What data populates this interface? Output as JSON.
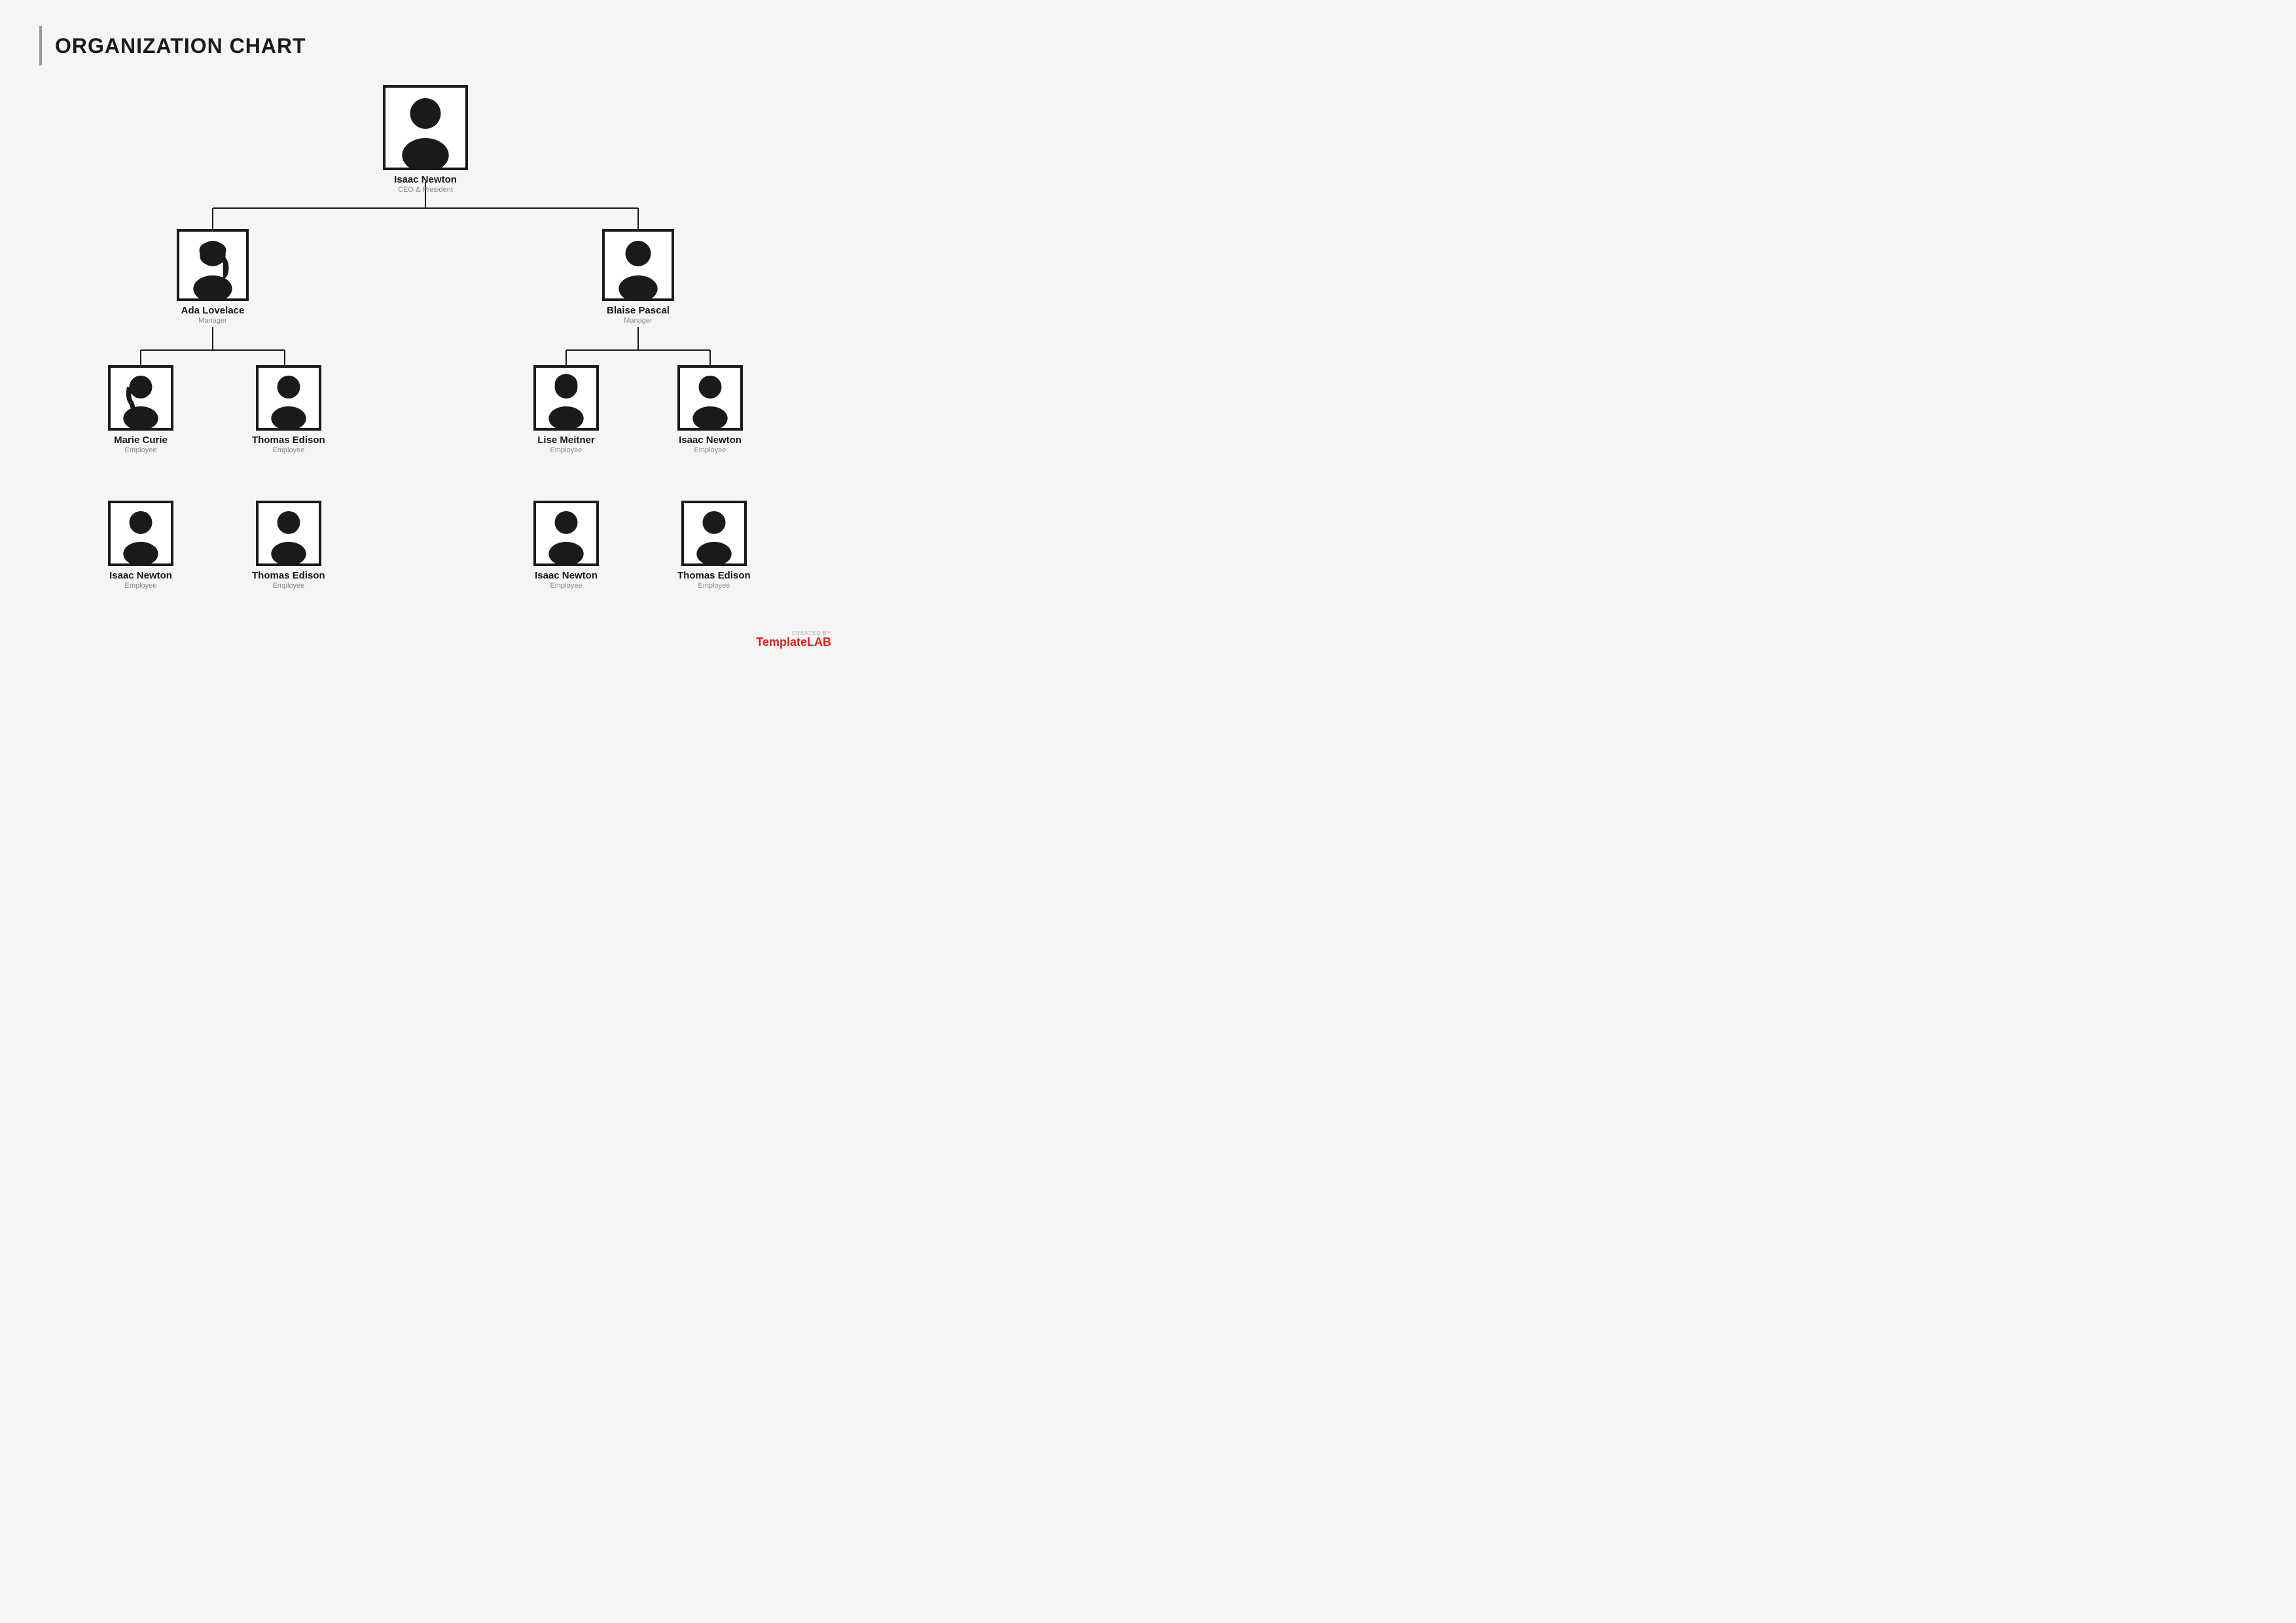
{
  "title": "ORGANIZATION CHART",
  "watermark": {
    "created_by": "CREATED BY",
    "brand_light": "Template",
    "brand_bold": "LAB"
  },
  "nodes": {
    "ceo": {
      "name": "Isaac Newton",
      "role": "CEO & President",
      "size": "large",
      "gender": "male"
    },
    "manager1": {
      "name": "Ada Lovelace",
      "role": "Manager",
      "size": "medium",
      "gender": "female"
    },
    "manager2": {
      "name": "Blaise Pascal",
      "role": "Manager",
      "size": "medium",
      "gender": "male"
    },
    "emp1": {
      "name": "Marie Curie",
      "role": "Employee",
      "size": "small",
      "gender": "female2"
    },
    "emp2": {
      "name": "Thomas Edison",
      "role": "Employee",
      "size": "small",
      "gender": "male2"
    },
    "emp3": {
      "name": "Lise Meitner",
      "role": "Employee",
      "size": "small",
      "gender": "female3"
    },
    "emp4": {
      "name": "Isaac Newton",
      "role": "Employee",
      "size": "small",
      "gender": "male3"
    },
    "emp5": {
      "name": "Isaac Newton",
      "role": "Employee",
      "size": "small",
      "gender": "male4"
    },
    "emp6": {
      "name": "Thomas Edison",
      "role": "Employee",
      "size": "small",
      "gender": "male5"
    },
    "emp7": {
      "name": "Isaac Newton",
      "role": "Employee",
      "size": "small",
      "gender": "male6"
    },
    "emp8": {
      "name": "Thomas Edison",
      "role": "Employee",
      "size": "small",
      "gender": "male7"
    }
  }
}
